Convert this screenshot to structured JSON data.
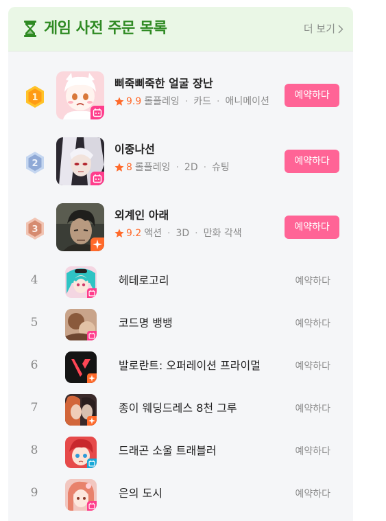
{
  "header": {
    "title": "게임 사전 주문 목록",
    "more_label": "더 보기",
    "accent_color": "#2f8a23",
    "icon": "hourglass-icon"
  },
  "top_games": [
    {
      "rank": "1",
      "name": "삐죽삐죽한 얼굴 장난",
      "rating": "9.9",
      "tags": [
        "롤플레잉",
        "카드",
        "애니메이션"
      ],
      "reserve_label": "예약하다",
      "medal": "gold",
      "badge": "calendar-icon"
    },
    {
      "rank": "2",
      "name": "이중나선",
      "rating": "8",
      "tags": [
        "롤플레잉",
        "2D",
        "슈팅"
      ],
      "reserve_label": "예약하다",
      "medal": "silver",
      "badge": "calendar-icon"
    },
    {
      "rank": "3",
      "name": "외계인 아래",
      "rating": "9.2",
      "tags": [
        "액션",
        "3D",
        "만화 각색"
      ],
      "reserve_label": "예약하다",
      "medal": "bronze",
      "badge": "sparkle-icon"
    }
  ],
  "games": [
    {
      "rank": "4",
      "name": "헤테로고리",
      "reserve_label": "예약하다",
      "badge": "calendar-icon"
    },
    {
      "rank": "5",
      "name": "코드명 뱅뱅",
      "reserve_label": "예약하다",
      "badge": "calendar-icon"
    },
    {
      "rank": "6",
      "name": "발로란트: 오퍼레이션 프라이멀",
      "reserve_label": "예약하다",
      "badge": "sparkle-icon"
    },
    {
      "rank": "7",
      "name": "종이 웨딩드레스 8천 그루",
      "reserve_label": "예약하다",
      "badge": "sparkle-icon"
    },
    {
      "rank": "8",
      "name": "드래곤 소울 트래블러",
      "reserve_label": "예약하다",
      "badge": "calendar-icon"
    },
    {
      "rank": "9",
      "name": "은의 도시",
      "reserve_label": "예약하다",
      "badge": "calendar-icon"
    }
  ],
  "colors": {
    "reserve_button": "#ff6496",
    "rating": "#ff6a2b",
    "header_bg": "#eaf7e6",
    "panel_bg": "#f5f6f8"
  }
}
